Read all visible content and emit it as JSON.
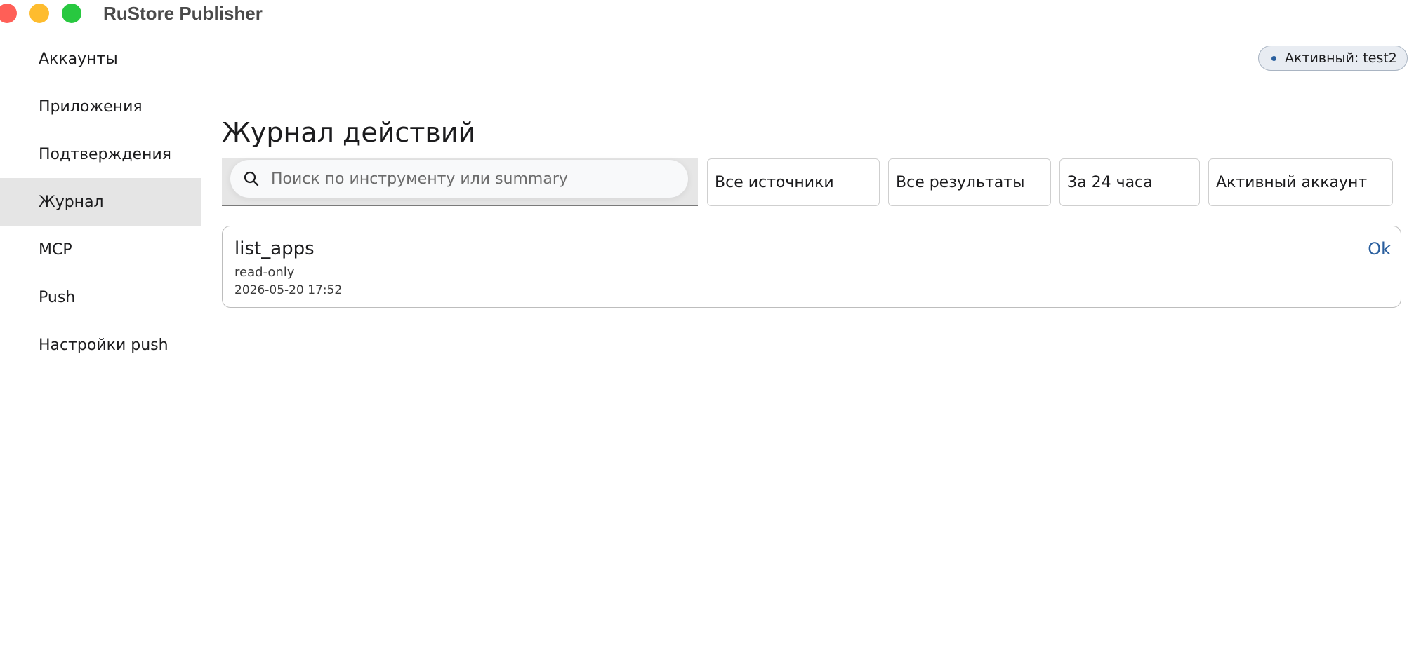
{
  "window": {
    "title": "RuStore Publisher"
  },
  "sidebar": {
    "items": [
      {
        "label": "Аккаунты"
      },
      {
        "label": "Приложения"
      },
      {
        "label": "Подтверждения"
      },
      {
        "label": "Журнал",
        "active": true
      },
      {
        "label": "MCP"
      },
      {
        "label": "Push"
      },
      {
        "label": "Настройки push"
      }
    ]
  },
  "header": {
    "account_badge": "Активный: test2"
  },
  "main": {
    "title": "Журнал действий",
    "search": {
      "placeholder": "Поиск по инструменту или summary",
      "value": ""
    },
    "filters": {
      "sources": "Все источники",
      "results": "Все результаты",
      "period": "За 24 часа",
      "account": "Активный аккаунт"
    },
    "log_entries": [
      {
        "tool": "list_apps",
        "mode": "read-only",
        "timestamp": "2026-05-20 17:52",
        "status": "Ok"
      }
    ]
  },
  "colors": {
    "accent": "#2a5f9e",
    "active_item_bg": "#e5e5e5",
    "close": "#ff5f57",
    "minimize": "#febc2e",
    "maximize": "#28c840"
  },
  "icons": {
    "search": "search-icon"
  }
}
